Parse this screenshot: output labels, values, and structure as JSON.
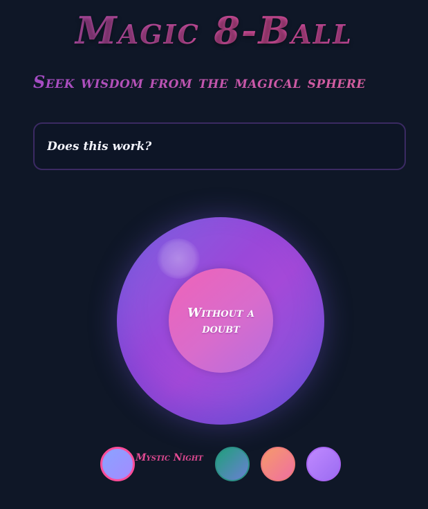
{
  "header": {
    "title": "Magic 8-Ball",
    "subtitle": "Seek wisdom from the magical sphere"
  },
  "question": {
    "value": "Does this work?",
    "placeholder": ""
  },
  "ball": {
    "answer": "Without a doubt"
  },
  "themes": {
    "selected_label": "Mystic Night",
    "items": [
      {
        "name": "mystic-night",
        "selected": true,
        "colors": [
          "#8aa3ff",
          "#a38bff"
        ],
        "border": "#ff4d9a"
      },
      {
        "name": "emerald",
        "selected": false,
        "colors": [
          "#1fa07a",
          "#6b7fd4"
        ],
        "border": "#2c8f86"
      },
      {
        "name": "sunset",
        "selected": false,
        "colors": [
          "#f69a6a",
          "#ef6fa1"
        ],
        "border": "#ee7a7a"
      },
      {
        "name": "violet",
        "selected": false,
        "colors": [
          "#c089ff",
          "#9b6cf1"
        ],
        "border": "#a866f2"
      }
    ]
  },
  "colors": {
    "background": "#0f1727",
    "accent": "#c04a9c",
    "ball_primary": "#9a48d9",
    "answer_window": "#ef63b8"
  }
}
